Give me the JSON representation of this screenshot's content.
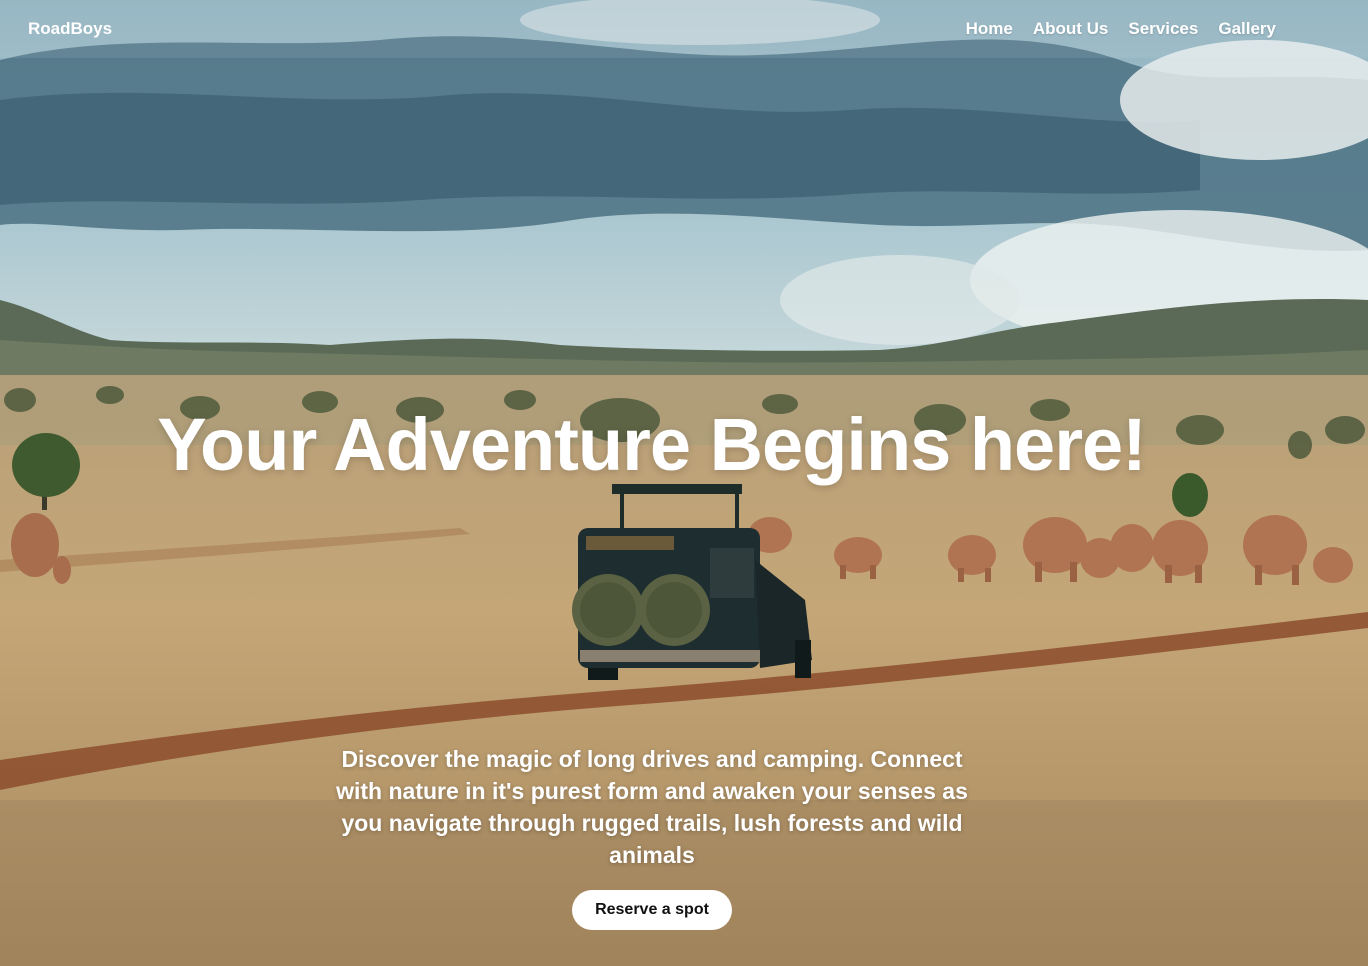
{
  "nav": {
    "brand": "RoadBoys",
    "links": [
      "Home",
      "About Us",
      "Services",
      "Gallery"
    ]
  },
  "hero": {
    "headline": "Your Adventure Begins here!",
    "tagline": "Discover the magic of long drives and camping. Connect with nature in it's purest form and awaken your senses as you navigate through rugged trails, lush forests and wild animals",
    "cta_label": "Reserve a spot",
    "background_image": "safari-savanna-elephants-jeep-photo"
  },
  "colors": {
    "sky": "#7fa9b8",
    "cloud": "#3f6577",
    "grass": "#c2a476",
    "dirt_road": "#8a4a2a",
    "hills": "#4d5c45",
    "text": "#ffffff",
    "button_bg": "#ffffff",
    "button_text": "#111111"
  }
}
